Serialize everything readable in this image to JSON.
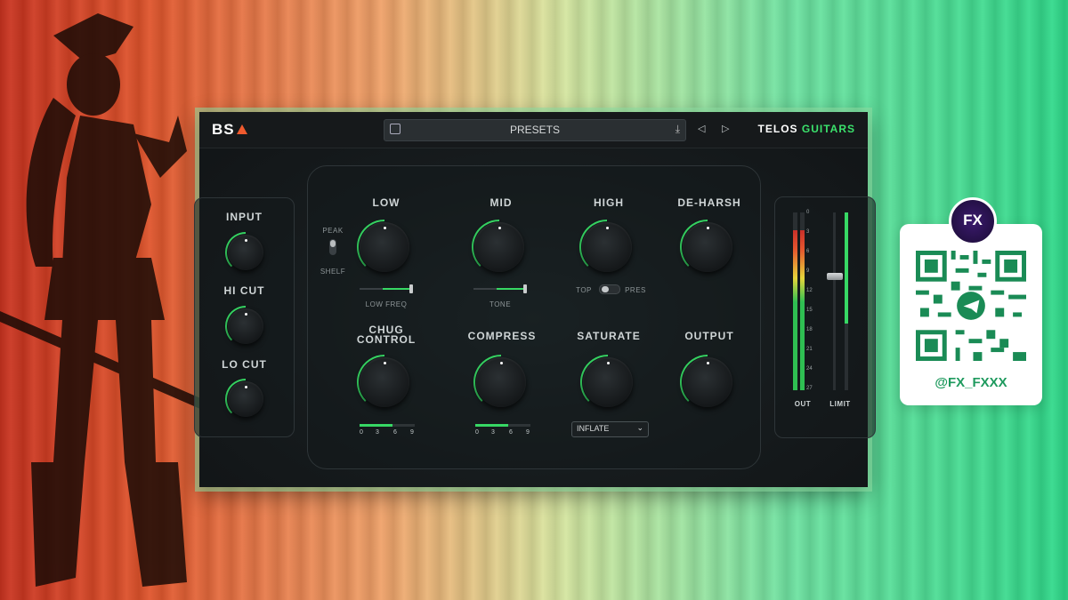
{
  "header": {
    "logo": "BS",
    "presets_label": "PRESETS",
    "brand_left": "TELOS",
    "brand_right": "GUITARS"
  },
  "input_panel": {
    "input": "INPUT",
    "hi_cut": "HI CUT",
    "lo_cut": "LO CUT"
  },
  "eq": {
    "low": "LOW",
    "mid": "MID",
    "high": "HIGH",
    "deharsh": "DE-HARSH",
    "peak": "PEAK",
    "shelf": "SHELF",
    "low_freq": "LOW FREQ",
    "tone": "TONE",
    "top": "TOP",
    "pres": "PRES"
  },
  "dynamics": {
    "chug_line1": "CHUG",
    "chug_line2": "CONTROL",
    "compress": "COMPRESS",
    "saturate": "SATURATE",
    "output": "OUTPUT",
    "ticks": [
      "0",
      "3",
      "6",
      "9"
    ],
    "chug_level": 0.6,
    "compress_level": 0.6,
    "saturate_mode": "INFLATE"
  },
  "meters": {
    "scale": [
      "0",
      "3",
      "6",
      "9",
      "12",
      "15",
      "18",
      "21",
      "24",
      "27"
    ],
    "out_label": "OUT",
    "limit_label": "LIMIT"
  },
  "qr": {
    "avatar_text": "FX",
    "handle": "@FX_FXXX"
  },
  "colors": {
    "accent_green": "#37d864",
    "brand_orange": "#ef5a2e"
  }
}
